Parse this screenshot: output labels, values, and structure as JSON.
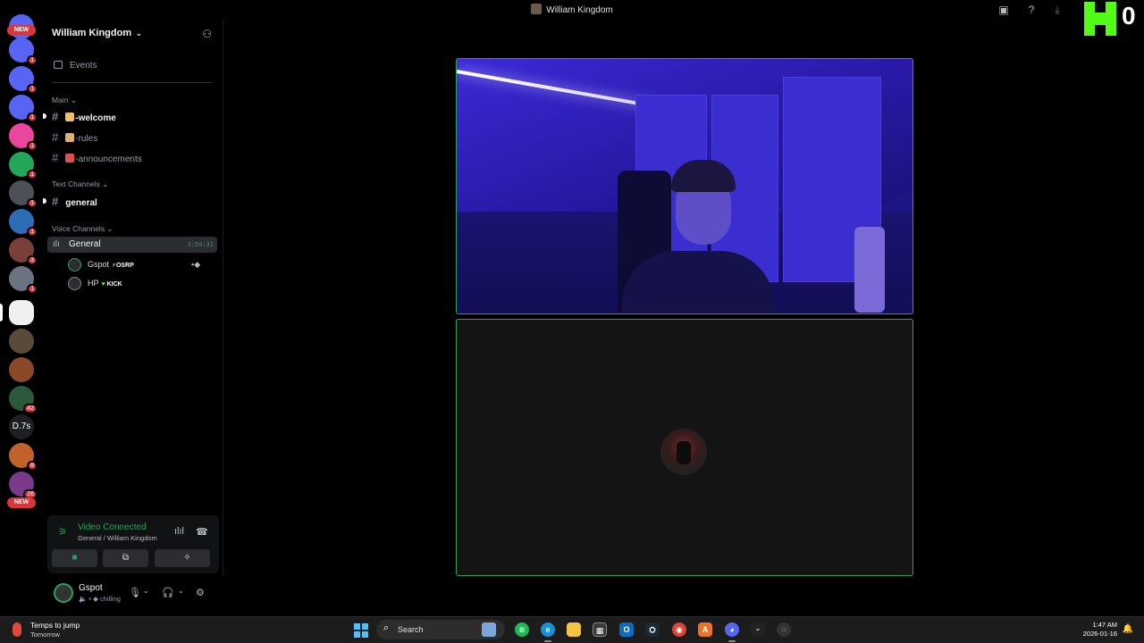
{
  "window": {
    "title": "William Kingdom"
  },
  "kick_overlay": {
    "count": "0",
    "color": "#53fc18"
  },
  "rail": {
    "new_top": "NEW",
    "new_bottom": "NEW",
    "text_server": "D.7s",
    "badges": [
      "1",
      "1",
      "1",
      "1",
      "1",
      "1",
      "1",
      "3",
      "1",
      "42",
      "8",
      "26"
    ]
  },
  "server": {
    "name": "William Kingdom",
    "events": "Events"
  },
  "categories": {
    "main": "Main",
    "text": "Text Channels",
    "voice": "Voice Channels"
  },
  "channels": {
    "welcome": "-welcome",
    "rules": "-rules",
    "announcements": "-announcements",
    "general": "general"
  },
  "voice_channel": {
    "name": "General",
    "timer": "3:59:31"
  },
  "voice_users": [
    {
      "name": "Gspot",
      "tag": "OSRP",
      "tag_color": "#ffffff"
    },
    {
      "name": "HP",
      "tag": "KICK",
      "tag_color": "#53fc18"
    }
  ],
  "voice_panel": {
    "status": "Video Connected",
    "location": "General / William Kingdom",
    "accent": "#23a55a"
  },
  "user_panel": {
    "name": "Gspot",
    "status": "chilling"
  },
  "taskbar": {
    "weather_title": "Temps to jump",
    "weather_sub": "Tomorrow",
    "search_placeholder": "Search",
    "time": "1:47 AM",
    "date": "2026-01-16"
  }
}
